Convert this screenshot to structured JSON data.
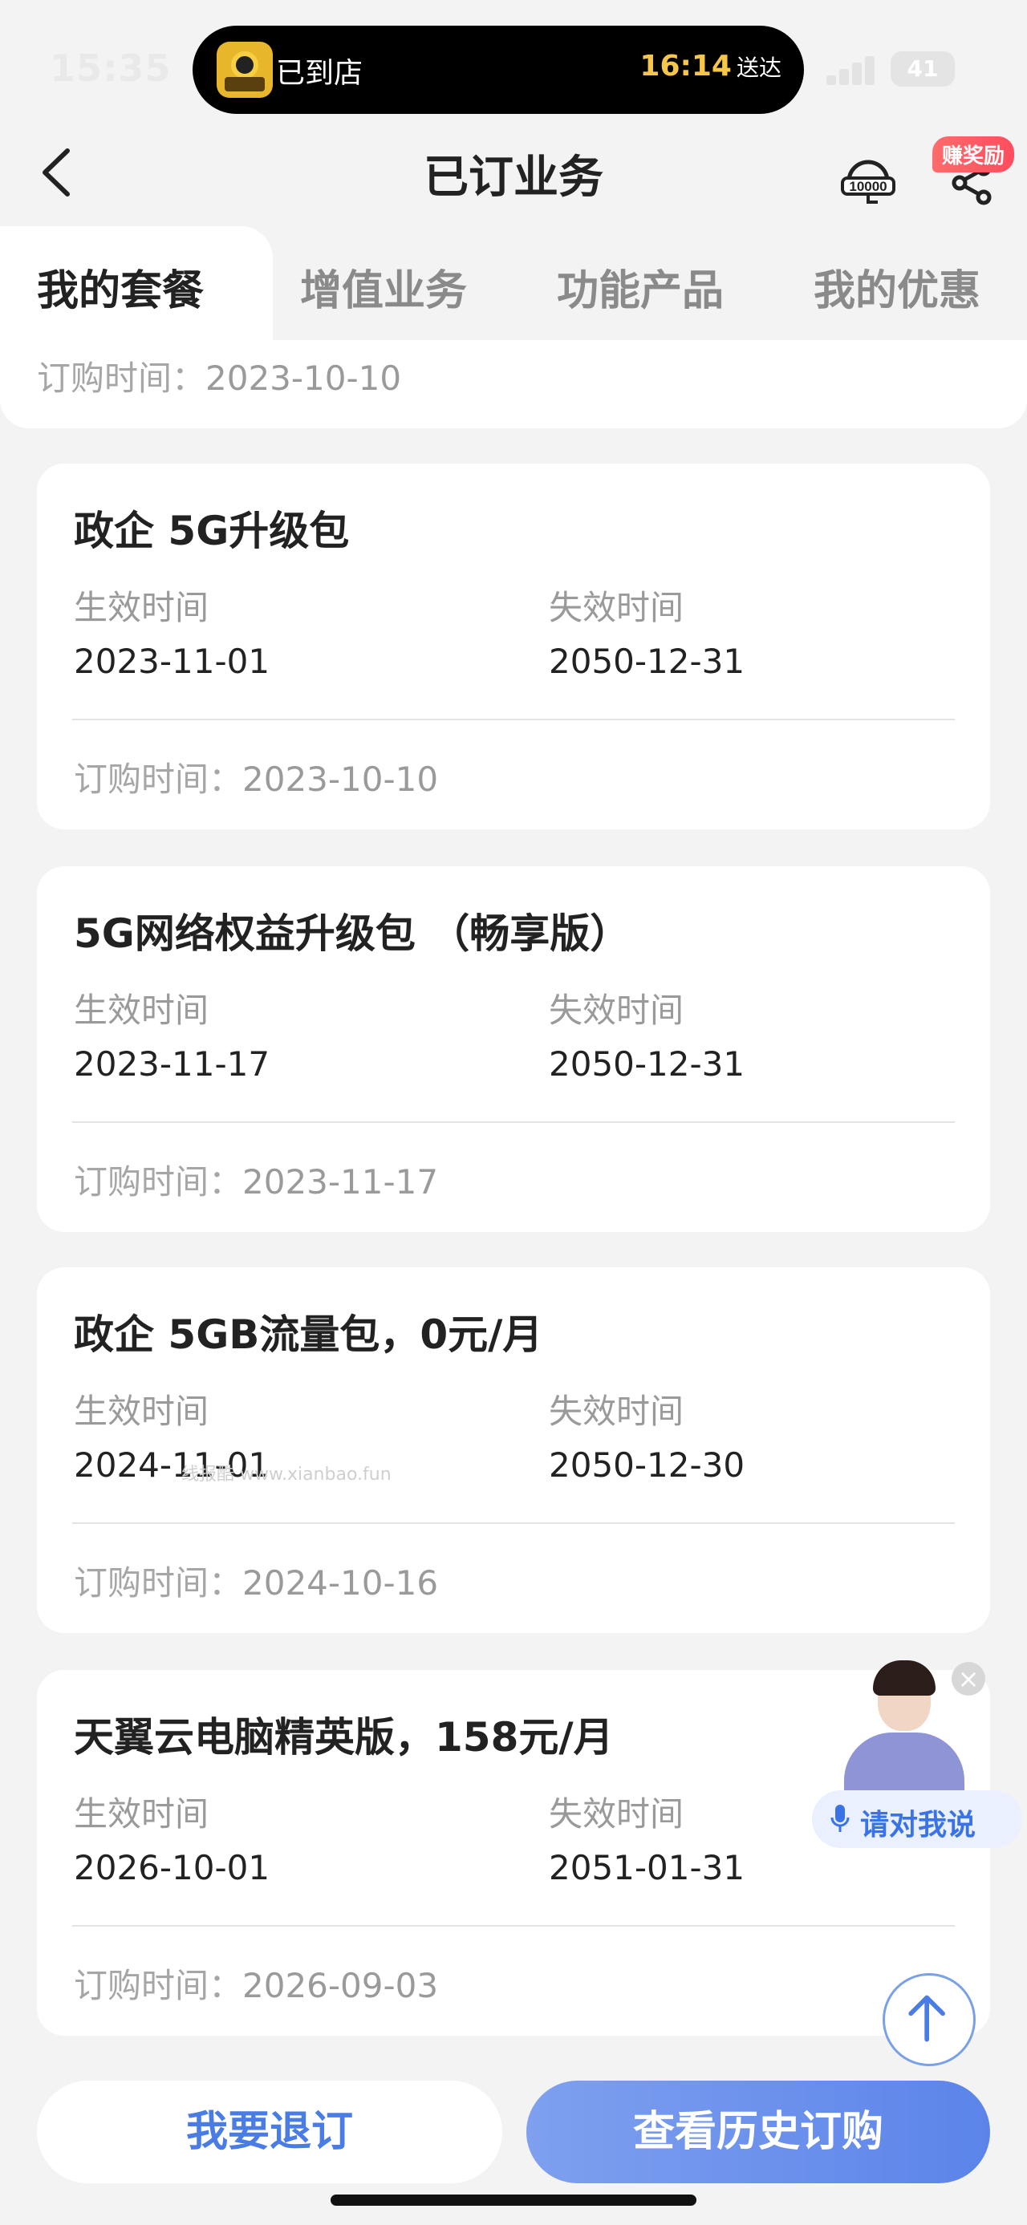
{
  "status_bar": {
    "time": "15:35",
    "island_status": "已到店",
    "island_eta_time": "16:14",
    "island_eta_suffix": "送达",
    "battery_level": "41",
    "icons": [
      "delivery-rider-icon",
      "signal-icon",
      "battery-icon"
    ]
  },
  "header": {
    "title": "已订业务",
    "reward_badge": "赚奖励",
    "icons": [
      "back-chevron-icon",
      "customer-service-icon",
      "share-icon"
    ]
  },
  "tabs": [
    {
      "label": "我的套餐",
      "active": true
    },
    {
      "label": "增值业务",
      "active": false
    },
    {
      "label": "功能产品",
      "active": false
    },
    {
      "label": "我的优惠",
      "active": false
    }
  ],
  "labels": {
    "effective": "生效时间",
    "expire": "失效时间",
    "order_prefix": "订购时间："
  },
  "partial_card": {
    "order_date": "2023-10-10"
  },
  "cards": [
    {
      "title": "政企 5G升级包",
      "effective": "2023-11-01",
      "expire": "2050-12-31",
      "order_date": "2023-10-10"
    },
    {
      "title": "5G网络权益升级包 （畅享版）",
      "effective": "2023-11-17",
      "expire": "2050-12-31",
      "order_date": "2023-11-17"
    },
    {
      "title": "政企 5GB流量包，0元/月",
      "effective": "2024-11-01",
      "expire": "2050-12-30",
      "order_date": "2024-10-16"
    },
    {
      "title": "天翼云电脑精英版，158元/月",
      "effective": "2026-10-01",
      "expire": "2051-01-31",
      "order_date": "2026-09-03"
    }
  ],
  "watermark": "线报酷 www.xianbao.fun",
  "assistant": {
    "voice_label": "请对我说",
    "close": "×"
  },
  "bottom": {
    "cancel_label": "我要退订",
    "history_label": "查看历史订购"
  },
  "colors": {
    "accent_blue": "#5b84ea",
    "badge_red": "#ff4d5e",
    "eta_gold": "#f6c64a"
  }
}
